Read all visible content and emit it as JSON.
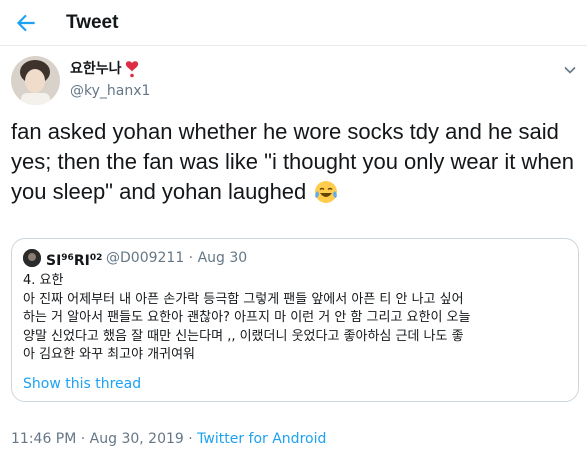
{
  "header": {
    "title": "Tweet"
  },
  "author": {
    "display_name": "요한누나",
    "handle": "@ky_hanx1"
  },
  "tweet": {
    "text": "fan asked yohan whether he wore socks tdy and he said yes; then the fan was like \"i thought you only wear it when you sleep\" and yohan laughed"
  },
  "quote": {
    "name_main": "SI",
    "name_sup1": "96",
    "name_mid": "RI",
    "name_sup2": "02",
    "handle_date": "@D009211 · Aug 30",
    "body": "4. 요한\n아 진짜 어제부터 내 아픈 손가락 등극함 그렇게 팬들 앞에서 아픈 티 안 나고 싶어\n하는 거 알아서 팬들도 요한아 괜찮아? 아프지 마 이런 거 안 함 그리고 요한이 오늘\n양말 신었다고 했음 잘 때만 신는다며 ,, 이랬더니 웃었다고 좋아하심 근데 나도 좋\n아 김요한 와꾸 최고야 개귀여워",
    "show_thread": "Show this thread"
  },
  "meta": {
    "timestamp": "11:46 PM · Aug 30, 2019 · ",
    "source": "Twitter for Android"
  },
  "colors": {
    "accent": "#1da1f2",
    "secondary_text": "#657786",
    "border": "#ccd6dd"
  },
  "icons": [
    "back-arrow-icon",
    "red-heart-icon",
    "chevron-down-icon",
    "tears-of-joy-icon"
  ]
}
